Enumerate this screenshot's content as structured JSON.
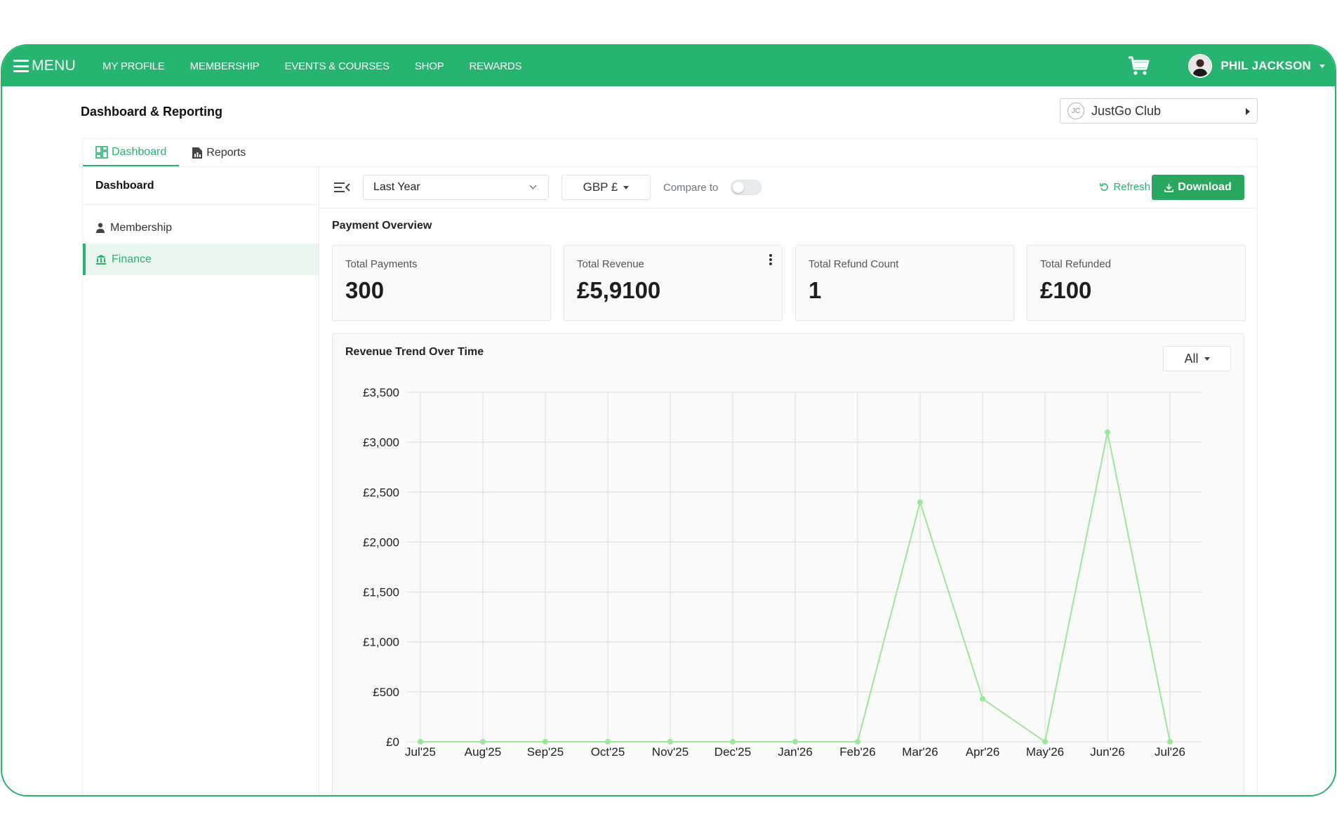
{
  "topbar": {
    "menu_label": "MENU",
    "nav": [
      "MY PROFILE",
      "MEMBERSHIP",
      "EVENTS & COURSES",
      "SHOP",
      "REWARDS"
    ],
    "user_name": "PHIL JACKSON"
  },
  "page": {
    "title": "Dashboard & Reporting",
    "club_initials": "JC",
    "club_name": "JustGo Club"
  },
  "tabs": [
    {
      "label": "Dashboard",
      "icon": "dashboard-icon",
      "active": true
    },
    {
      "label": "Reports",
      "icon": "report-icon",
      "active": false
    }
  ],
  "sidebar": {
    "heading": "Dashboard",
    "items": [
      {
        "label": "Membership",
        "icon": "person-icon",
        "active": false
      },
      {
        "label": "Finance",
        "icon": "bank-icon",
        "active": true
      }
    ]
  },
  "filters": {
    "period": "Last Year",
    "currency": "GBP £",
    "compare_label": "Compare to",
    "compare_enabled": false,
    "refresh_label": "Refresh",
    "download_label": "Download"
  },
  "overview": {
    "title": "Payment Overview",
    "cards": [
      {
        "label": "Total Payments",
        "value": "300"
      },
      {
        "label": "Total Revenue",
        "value": "£5,9100"
      },
      {
        "label": "Total Refund Count",
        "value": "1"
      },
      {
        "label": "Total Refunded",
        "value": "£100"
      }
    ]
  },
  "chart_title": "Revenue Trend Over Time",
  "chart_filter": "All",
  "colors": {
    "brand": "#27b46f",
    "download": "#27a85e",
    "line": "#9ee59e"
  },
  "chart_data": {
    "type": "line",
    "title": "Revenue Trend Over Time",
    "xlabel": "",
    "ylabel": "",
    "categories": [
      "Jul'25",
      "Aug'25",
      "Sep'25",
      "Oct'25",
      "Nov'25",
      "Dec'25",
      "Jan'26",
      "Feb'26",
      "Mar'26",
      "Apr'26",
      "May'26",
      "Jun'26",
      "Jul'26"
    ],
    "series": [
      {
        "values": [
          0,
          0,
          0,
          0,
          0,
          0,
          0,
          0,
          2400,
          430,
          0,
          3100,
          0
        ]
      }
    ],
    "ylim": [
      0,
      3500
    ],
    "yticks": [
      0,
      500,
      1000,
      1500,
      2000,
      2500,
      3000,
      3500
    ],
    "ytick_labels": [
      "£0",
      "£500",
      "£1,000",
      "£1,500",
      "£2,000",
      "£2,500",
      "£3,000",
      "£3,500"
    ],
    "grid": true,
    "legend": "none"
  }
}
